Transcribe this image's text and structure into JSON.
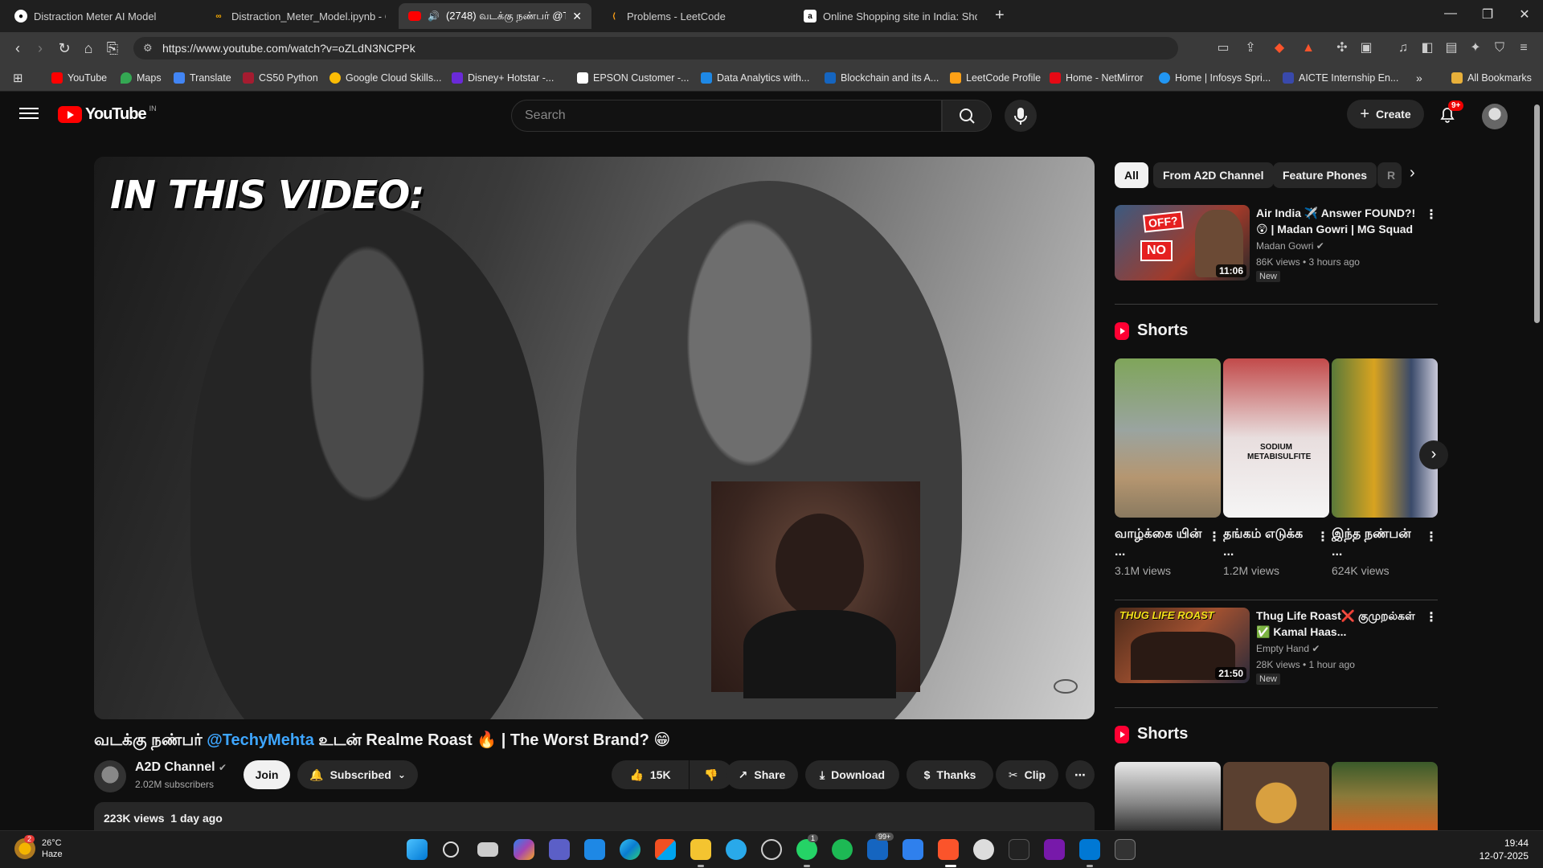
{
  "browser": {
    "tabs": [
      {
        "label": "Distraction Meter AI Model",
        "icon": "github-icon"
      },
      {
        "label": "Distraction_Meter_Model.ipynb - Col",
        "icon": "colab-icon"
      },
      {
        "label": "(2748) வடக்கு நண்பர் @T",
        "icon": "youtube-icon",
        "active": true
      },
      {
        "label": "Problems - LeetCode",
        "icon": "leetcode-icon"
      },
      {
        "label": "Online Shopping site in India: Shop C",
        "icon": "amazon-icon"
      }
    ],
    "url": "https://www.youtube.com/watch?v=oZLdN3NCPPk",
    "bookmarks": [
      {
        "label": "YouTube",
        "color": "#ff0000"
      },
      {
        "label": "Maps",
        "color": "#34a853"
      },
      {
        "label": "Translate",
        "color": "#4285f4"
      },
      {
        "label": "CS50 Python",
        "color": "#a51c30"
      },
      {
        "label": "Google Cloud Skills...",
        "color": "#fbbc05"
      },
      {
        "label": "Disney+ Hotstar -...",
        "color": "#6a2ad8"
      },
      {
        "label": "EPSON Customer -...",
        "color": "#ffffff"
      },
      {
        "label": "Data Analytics with...",
        "color": "#1e88e5"
      },
      {
        "label": "Blockchain and its A...",
        "color": "#1565c0"
      },
      {
        "label": "LeetCode Profile",
        "color": "#ffa116"
      },
      {
        "label": "Home - NetMirror",
        "color": "#e50914"
      },
      {
        "label": "Home | Infosys Spri...",
        "color": "#2196f3"
      },
      {
        "label": "AICTE Internship En...",
        "color": "#3949ab"
      }
    ],
    "all_bookmarks": "All Bookmarks",
    "overflow": "»"
  },
  "youtube": {
    "logo_text": "YouTube",
    "country": "IN",
    "search_placeholder": "Search",
    "create_label": "Create",
    "notif_badge": "9+"
  },
  "player": {
    "overlay_text": "IN THIS VIDEO:"
  },
  "video": {
    "title_prefix": "வடக்கு நண்பர் ",
    "title_mention": "@TechyMehta",
    "title_suffix": " உடன் Realme Roast 🔥 | The Worst Brand? 😁",
    "channel": "A2D Channel",
    "subscribers": "2.02M subscribers",
    "join": "Join",
    "subscribed": "Subscribed",
    "likes": "15K",
    "share": "Share",
    "download": "Download",
    "thanks": "Thanks",
    "clip": "Clip",
    "views": "223K views",
    "age": "1 day ago"
  },
  "sidebar": {
    "chips": [
      "All",
      "From A2D Channel",
      "Feature Phones",
      "R"
    ],
    "recommendations": [
      {
        "title": "Air India ✈️ Answer FOUND?! 😲 | Madan Gowri | MG Squad ...",
        "channel": "Madan Gowri",
        "meta": "86K views • 3 hours ago",
        "badge": "New",
        "duration": "11:06",
        "thumb_text_1": "OFF?",
        "thumb_text_2": "NO"
      },
      {
        "title": "Thug Life Roast❌ குமுறல்கள் ✅ Kamal Haas...",
        "channel": "Empty Hand",
        "meta": "28K views • 1 hour ago",
        "badge": "New",
        "duration": "21:50",
        "thumb_text_1": "THUG LIFE ROAST"
      }
    ],
    "shorts_label": "Shorts",
    "shorts": [
      {
        "title": "வாழ்க்கை யின் ...",
        "views": "3.1M views"
      },
      {
        "title": "தங்கம் எடுக்க ...",
        "views": "1.2M views",
        "thumb_text": "SODIUM METABISULFITE"
      },
      {
        "title": "இந்த நண்பன் ...",
        "views": "624K views"
      }
    ]
  },
  "taskbar": {
    "temp": "26°C",
    "weather": "Haze",
    "weather_badge": "2",
    "time": "19:44",
    "date": "12-07-2025",
    "mail_badge": "99+",
    "whatsapp_badge": "1"
  }
}
